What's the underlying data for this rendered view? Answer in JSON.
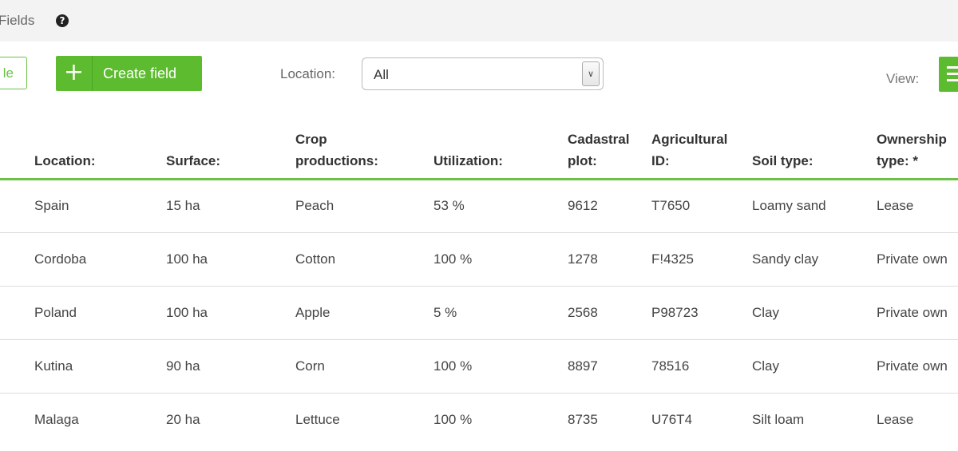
{
  "header": {
    "title": "Fields",
    "help_icon": "?"
  },
  "toolbar": {
    "partial_button_label": "le",
    "create_label": "Create field",
    "create_icon": "+",
    "location_label": "Location:",
    "location_value": "All",
    "view_label": "View:"
  },
  "table": {
    "columns": [
      [
        "Location:"
      ],
      [
        "Surface:"
      ],
      [
        "Crop",
        "productions:"
      ],
      [
        "Utilization:"
      ],
      [
        "Cadastral",
        "plot:"
      ],
      [
        "Agricultural",
        "ID:"
      ],
      [
        "Soil type:"
      ],
      [
        "Ownership",
        "type: *"
      ]
    ],
    "rows": [
      [
        "Spain",
        "15 ha",
        "Peach",
        "53 %",
        "9612",
        "T7650",
        "Loamy sand",
        "Lease"
      ],
      [
        "Cordoba",
        "100 ha",
        "Cotton",
        "100 %",
        "1278",
        "F!4325",
        "Sandy clay",
        "Private own"
      ],
      [
        "Poland",
        "100 ha",
        "Apple",
        "5 %",
        "2568",
        "P98723",
        "Clay",
        "Private own"
      ],
      [
        "Kutina",
        "90 ha",
        "Corn",
        "100 %",
        "8897",
        "78516",
        "Clay",
        "Private own"
      ],
      [
        "Malaga",
        "20 ha",
        "Lettuce",
        "100 %",
        "8735",
        "U76T4",
        "Silt loam",
        "Lease"
      ]
    ]
  },
  "colors": {
    "accent": "#5dbb2f",
    "topbar": "#f3f3f3"
  }
}
